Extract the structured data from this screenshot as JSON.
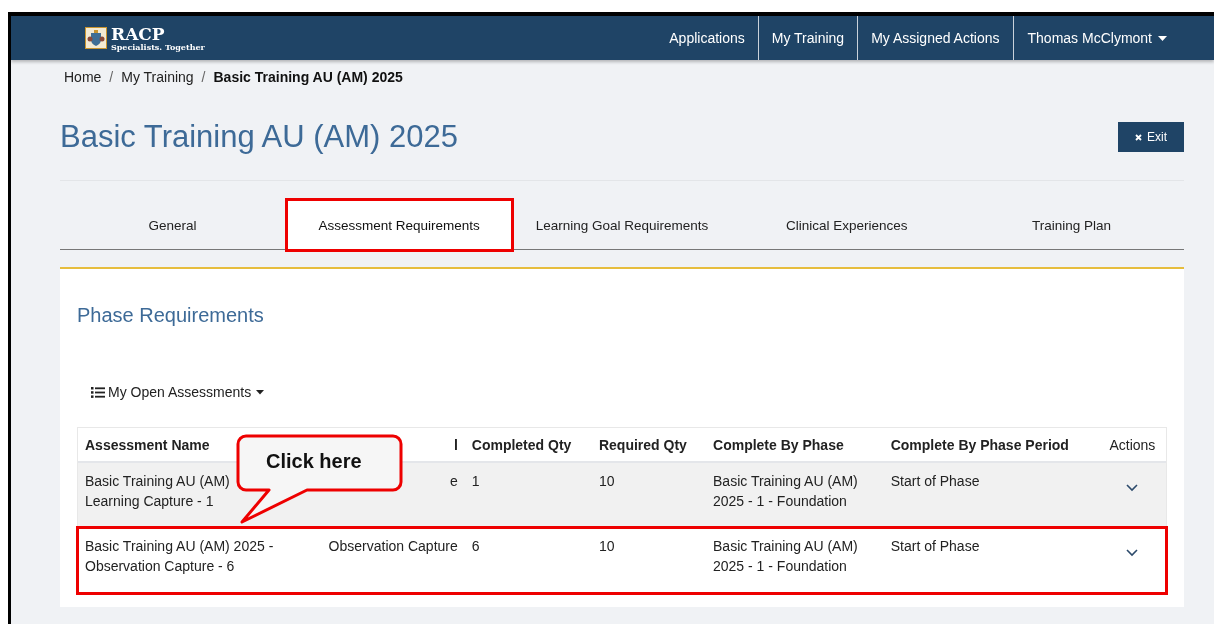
{
  "brand": {
    "name": "RACP",
    "tagline": "Specialists. Together"
  },
  "nav": [
    {
      "label": "Applications",
      "kind": "link"
    },
    {
      "label": "My Training",
      "kind": "link"
    },
    {
      "label": "My Assigned Actions",
      "kind": "link"
    },
    {
      "label": "Thomas McClymont",
      "kind": "dropdown"
    }
  ],
  "breadcrumb": [
    {
      "kind": "link",
      "label": "Home",
      "current": false
    },
    {
      "kind": "separator",
      "label": "/"
    },
    {
      "kind": "link",
      "label": "My Training",
      "current": false
    },
    {
      "kind": "separator",
      "label": "/"
    },
    {
      "kind": "link",
      "label": "Basic Training AU (AM) 2025",
      "current": true
    }
  ],
  "title": "Basic Training AU (AM) 2025",
  "exit_button": "Exit",
  "tabs": [
    {
      "label": "General",
      "selected": false,
      "highlighted": false
    },
    {
      "label": "Assessment Requirements",
      "selected": true,
      "highlighted": true
    },
    {
      "label": "Learning Goal Requirements",
      "selected": false,
      "highlighted": false
    },
    {
      "label": "Clinical Experiences",
      "selected": false,
      "highlighted": false
    },
    {
      "label": "Training Plan",
      "selected": false,
      "highlighted": false
    }
  ],
  "section_title": "Phase Requirements",
  "filter_dropdown": "My Open Assessments",
  "table": {
    "columns": [
      "Assessment Name",
      "l",
      "Completed Qty",
      "Required Qty",
      "Complete By Phase",
      "Complete By Phase Period",
      "Actions"
    ],
    "rows": [
      {
        "cells": [
          "Basic Training AU (AM)\nLearning Capture - 1",
          "e",
          "1",
          "10",
          "Basic Training AU (AM)\n2025 - 1 - Foundation",
          "Start of Phase"
        ],
        "highlighted": false
      },
      {
        "cells": [
          "Basic Training AU (AM) 2025 -\nObservation Capture - 6",
          "Observation Capture",
          "6",
          "10",
          "Basic Training AU (AM)\n2025 - 1 - Foundation",
          "Start of Phase"
        ],
        "highlighted": true
      }
    ]
  },
  "callout": {
    "text": "Click here"
  }
}
